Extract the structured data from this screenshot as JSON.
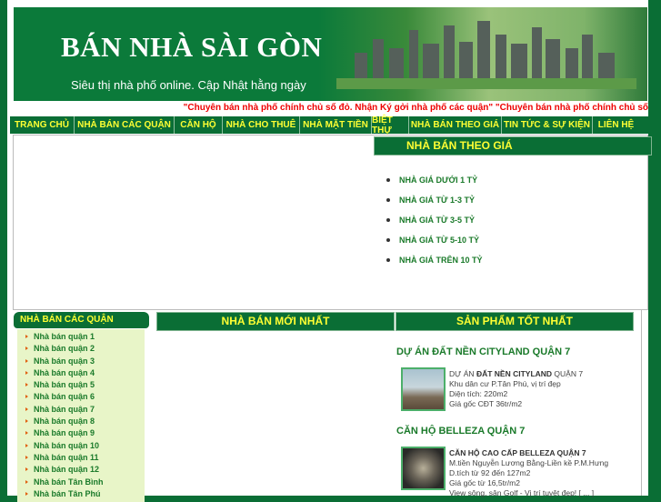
{
  "header": {
    "title": "BÁN NHÀ SÀI GÒN",
    "subtitle": "Siêu thị nhà phố online. Cập Nhật hằng ngày"
  },
  "marquee": "\"Chuyên bán nhà phố chính chủ sổ đỏ. Nhận Ký gởi nhà phố các quận\" \"Chuyên bán nhà phố chính chủ sổ",
  "nav": [
    "TRANG CHỦ",
    "NHÀ BÁN CÁC QUẬN",
    "CĂN HỘ",
    "NHÀ CHO THUÊ",
    "NHÀ MẶT TIỀN",
    "BIỆT THỰ",
    "NHÀ BÁN THEO GIÁ",
    "TIN TỨC & SỰ KIỆN",
    "LIÊN HỆ"
  ],
  "price": {
    "title": "NHÀ BÁN THEO GIÁ",
    "items": [
      "NHÀ GIÁ DƯỚI 1 TỶ",
      "NHÀ GIÁ TỪ 1-3 TỶ",
      "NHÀ GIÁ TỪ 3-5 TỶ",
      "NHÀ GIÁ TỪ 5-10 TỶ",
      "NHÀ GIÁ TRÊN 10 TỶ"
    ]
  },
  "sidebar": {
    "title": "NHÀ BÁN CÁC QUẬN",
    "items": [
      "Nhà bán quận 1",
      "Nhà bán quận 2",
      "Nhà bán quận 3",
      "Nhà bán quận 4",
      "Nhà bán quận 5",
      "Nhà bán quận 6",
      "Nhà bán quận 7",
      "Nhà bán quận 8",
      "Nhà bán quận 9",
      "Nhà bán quận 10",
      "Nhà bán quận 11",
      "Nhà bán quận 12",
      "Nhà bán Tân Bình",
      "Nhà bán Tân Phú"
    ]
  },
  "newest": {
    "title": "NHÀ BÁN MỚI NHẤT"
  },
  "best": {
    "title": "SẢN PHẨM TỐT NHẤT",
    "products": [
      {
        "title": "DỰ ÁN ĐẤT NỀN CITYLAND QUẬN 7",
        "pre": "DỰ ÁN ",
        "bold": "ĐẤT NỀN CITYLAND",
        "post": " QUẬN 7",
        "lines": [
          "Khu dân cư P.Tân Phú, vị trí đẹp",
          "Diện tích: 220m2",
          "Giá gốc CĐT 36tr/m2"
        ]
      },
      {
        "title": "CĂN HỘ BELLEZA QUẬN 7",
        "pre": "",
        "bold": "CĂN HỘ CAO CẤP BELLEZA QUẬN 7",
        "post": "",
        "lines": [
          "M.tiền Nguyễn Lương Bằng-Liền kề P.M.Hưng",
          "D.tích từ 92 đến 127m2",
          "Giá gốc từ 16,5tr/m2",
          "View sông, sân Golf - Vị trí tuyệt đẹp! [ ... ]"
        ]
      }
    ]
  }
}
